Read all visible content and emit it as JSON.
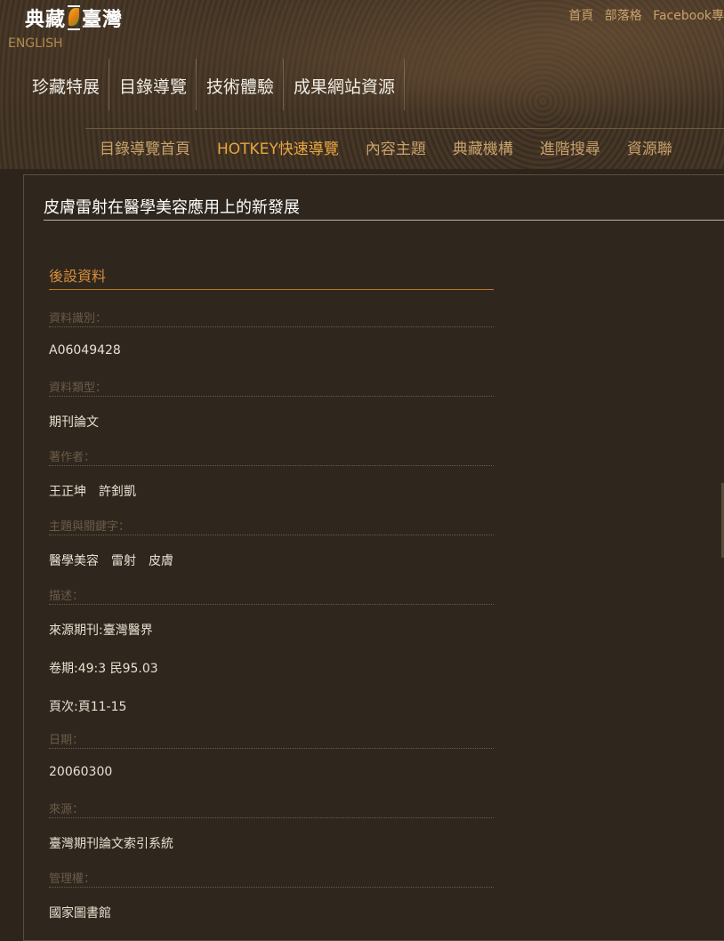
{
  "header": {
    "logo_part1": "典藏",
    "logo_part2": "臺灣",
    "english": "ENGLISH",
    "top_links": [
      "首頁",
      "部落格",
      "Facebook專"
    ],
    "main_nav": [
      "珍藏特展",
      "目錄導覽",
      "技術體驗",
      "成果網站資源"
    ],
    "sub_nav": [
      "目錄導覽首頁",
      "HOTKEY快速導覽",
      "內容主題",
      "典藏機構",
      "進階搜尋",
      "資源聯"
    ]
  },
  "record": {
    "title": "皮膚雷射在醫學美容應用上的新發展",
    "section": "後設資料",
    "fields": [
      {
        "label": "資料識別：",
        "values": [
          "A06049428"
        ]
      },
      {
        "label": "資料類型：",
        "values": [
          "期刊論文"
        ]
      },
      {
        "label": "著作者：",
        "values": [
          "王正坤　許釗凱"
        ]
      },
      {
        "label": "主題與關鍵字：",
        "values": [
          "醫學美容　雷射　皮膚"
        ]
      },
      {
        "label": "描述：",
        "values": [
          "來源期刊:臺灣醫界",
          "卷期:49:3 民95.03",
          "頁次:頁11-15"
        ]
      },
      {
        "label": "日期：",
        "values": [
          "20060300"
        ]
      },
      {
        "label": "來源：",
        "values": [
          "臺灣期刊論文索引系統"
        ]
      },
      {
        "label": "管理權：",
        "values": [
          "國家圖書館"
        ]
      }
    ]
  }
}
